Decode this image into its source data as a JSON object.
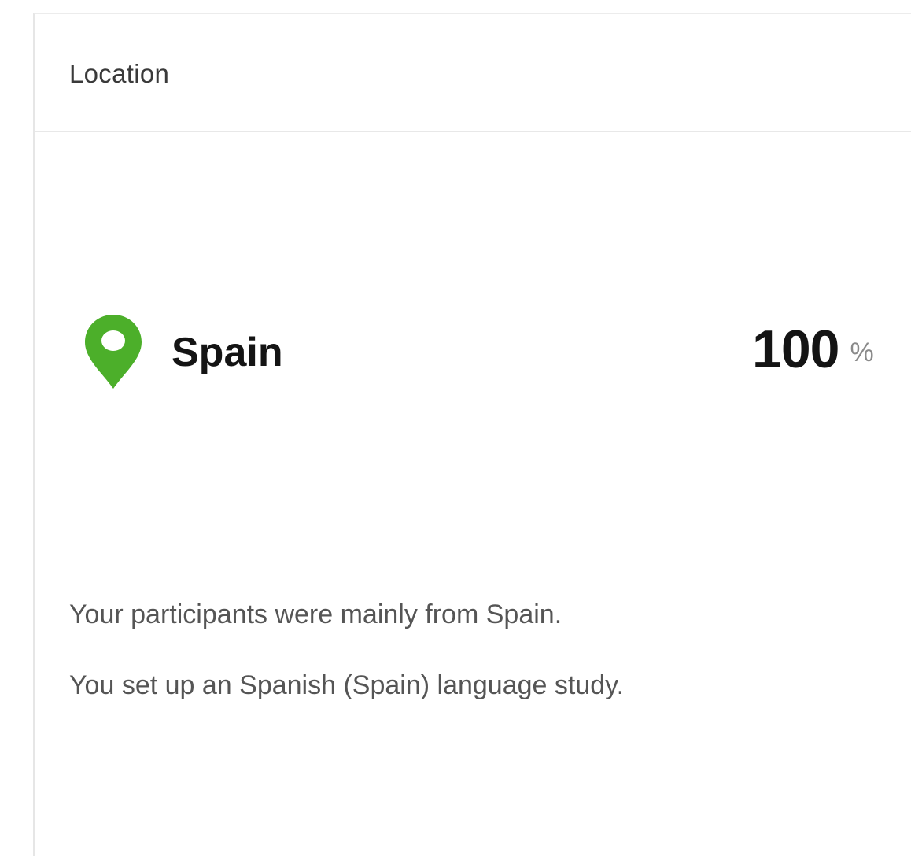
{
  "card": {
    "title": "Location"
  },
  "location": {
    "icon": "map-pin-icon",
    "icon_color": "#4caf2a",
    "country": "Spain",
    "percent_value": "100",
    "percent_unit": "%"
  },
  "summary": {
    "line1": "Your participants were mainly from Spain.",
    "line2": "You set up an Spanish (Spain) language study."
  }
}
